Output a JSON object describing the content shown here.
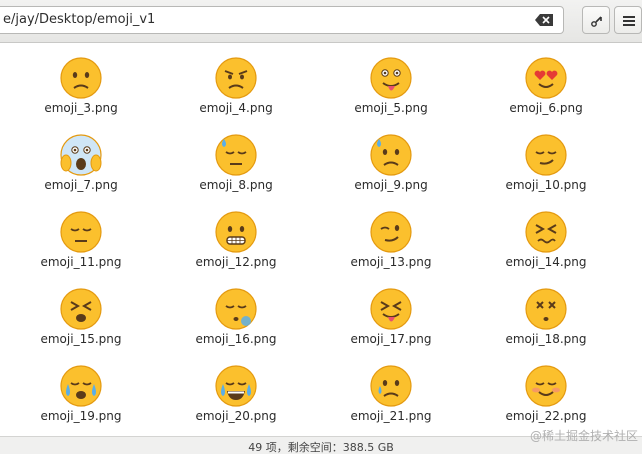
{
  "toolbar": {
    "path": "e/jay/Desktop/emoji_v1"
  },
  "icons": {
    "clear": "clear-text-icon",
    "search": "search-icon",
    "menu": "menu-icon"
  },
  "files": [
    {
      "name": "emoji_3.png",
      "face": "sad"
    },
    {
      "name": "emoji_4.png",
      "face": "angry"
    },
    {
      "name": "emoji_5.png",
      "face": "tongue-wink"
    },
    {
      "name": "emoji_6.png",
      "face": "heart-eyes"
    },
    {
      "name": "emoji_7.png",
      "face": "scream"
    },
    {
      "name": "emoji_8.png",
      "face": "sweat"
    },
    {
      "name": "emoji_9.png",
      "face": "worried-sweat"
    },
    {
      "name": "emoji_10.png",
      "face": "smirk"
    },
    {
      "name": "emoji_11.png",
      "face": "pensive"
    },
    {
      "name": "emoji_12.png",
      "face": "grimace"
    },
    {
      "name": "emoji_13.png",
      "face": "wink"
    },
    {
      "name": "emoji_14.png",
      "face": "confounded"
    },
    {
      "name": "emoji_15.png",
      "face": "tired"
    },
    {
      "name": "emoji_16.png",
      "face": "sleepy"
    },
    {
      "name": "emoji_17.png",
      "face": "squint-tongue"
    },
    {
      "name": "emoji_18.png",
      "face": "dizzy"
    },
    {
      "name": "emoji_19.png",
      "face": "sob"
    },
    {
      "name": "emoji_20.png",
      "face": "joy"
    },
    {
      "name": "emoji_21.png",
      "face": "cry"
    },
    {
      "name": "emoji_22.png",
      "face": "blush"
    }
  ],
  "status": {
    "text": "49 项，剩余空间：388.5 GB"
  },
  "watermark": "@稀土掘金技术社区",
  "colors": {
    "face": "#fbc02d",
    "face_edge": "#e49a10",
    "feature": "#5a3b1a",
    "tongue": "#e8506e",
    "tear": "#5aaee8"
  }
}
